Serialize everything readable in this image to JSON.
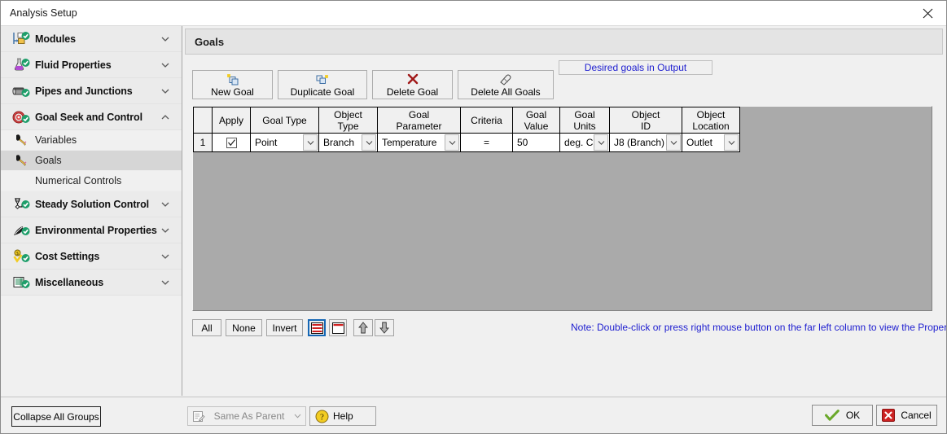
{
  "window": {
    "title": "Analysis Setup",
    "close_icon": "close-icon"
  },
  "sidebar": {
    "items": [
      {
        "label": "Modules",
        "icon": "modules-icon",
        "type": "group",
        "expanded": false,
        "selected": false
      },
      {
        "label": "Fluid Properties",
        "icon": "flask-icon",
        "type": "group",
        "expanded": false,
        "selected": false
      },
      {
        "label": "Pipes and Junctions",
        "icon": "pipe-icon",
        "type": "group",
        "expanded": false,
        "selected": false
      },
      {
        "label": "Goal Seek and Control",
        "icon": "target-icon",
        "type": "group",
        "expanded": true,
        "selected": false
      },
      {
        "label": "Variables",
        "icon": "variables-icon",
        "type": "sub",
        "selected": false
      },
      {
        "label": "Goals",
        "icon": "goals-icon",
        "type": "sub",
        "selected": true
      },
      {
        "label": "Numerical Controls",
        "icon": "",
        "type": "sub",
        "selected": false
      },
      {
        "label": "Steady Solution Control",
        "icon": "solution-icon",
        "type": "group",
        "expanded": false,
        "selected": false
      },
      {
        "label": "Environmental Properties",
        "icon": "leaf-icon",
        "type": "group",
        "expanded": false,
        "selected": false
      },
      {
        "label": "Cost Settings",
        "icon": "cost-icon",
        "type": "group",
        "expanded": false,
        "selected": false
      },
      {
        "label": "Miscellaneous",
        "icon": "list-icon",
        "type": "group",
        "expanded": false,
        "selected": false
      }
    ],
    "collapse_all_label": "Collapse All Groups"
  },
  "main": {
    "header_title": "Goals",
    "toolbar": [
      {
        "label": "New Goal",
        "icon": "new-goal-icon"
      },
      {
        "label": "Duplicate Goal",
        "icon": "duplicate-goal-icon"
      },
      {
        "label": "Delete Goal",
        "icon": "delete-goal-icon"
      },
      {
        "label": "Delete All Goals",
        "icon": "eraser-icon"
      }
    ],
    "desired_goals_label": "Desired goals in Output",
    "table": {
      "columns": [
        {
          "key": "rownum",
          "label": ""
        },
        {
          "key": "apply",
          "label": "Apply"
        },
        {
          "key": "goaltype",
          "label": "Goal Type"
        },
        {
          "key": "objtype",
          "label": "Object\nType"
        },
        {
          "key": "goalparam",
          "label": "Goal\nParameter"
        },
        {
          "key": "criteria",
          "label": "Criteria"
        },
        {
          "key": "goalvalue",
          "label": "Goal\nValue"
        },
        {
          "key": "goalunits",
          "label": "Goal\nUnits"
        },
        {
          "key": "objid",
          "label": "Object\nID"
        },
        {
          "key": "objloc",
          "label": "Object\nLocation"
        }
      ],
      "column_labels": {
        "rownum": "",
        "apply": "Apply",
        "goaltype": "Goal Type",
        "objtype_l1": "Object",
        "objtype_l2": "Type",
        "goalparam_l1": "Goal",
        "goalparam_l2": "Parameter",
        "criteria": "Criteria",
        "goalvalue_l1": "Goal",
        "goalvalue_l2": "Value",
        "goalunits_l1": "Goal",
        "goalunits_l2": "Units",
        "objid_l1": "Object",
        "objid_l2": "ID",
        "objloc_l1": "Object",
        "objloc_l2": "Location"
      },
      "rows": [
        {
          "rownum": "1",
          "apply": true,
          "goaltype": "Point",
          "objtype": "Branch",
          "goalparam": "Temperature",
          "criteria": "=",
          "goalvalue": "50",
          "goalunits": "deg. C",
          "objid": "J8 (Branch)",
          "objloc": "Outlet"
        }
      ]
    },
    "selection_bar": {
      "all_label": "All",
      "none_label": "None",
      "invert_label": "Invert",
      "view_all_rows_icon": "grid-all-rows-icon",
      "view_header_only_icon": "grid-header-only-icon",
      "move_up_icon": "arrow-up-icon",
      "move_down_icon": "arrow-down-icon"
    },
    "note": "Note: Double-click or press right mouse button on the far left column to view the Properties or inspection window for a pipe or junction."
  },
  "footer": {
    "parent_combo_value": "Same As Parent",
    "parent_combo_icon": "edit-note-icon",
    "help_label": "Help",
    "help_icon": "help-icon",
    "ok_label": "OK",
    "ok_icon": "check-icon",
    "cancel_label": "Cancel",
    "cancel_icon": "cancel-icon"
  },
  "colors": {
    "accent_blue": "#2020d0",
    "grid_background": "#aaaaaa",
    "panel": "#f0f0f0",
    "selected_item": "#d6d6d6",
    "ok_green": "#6aa82a",
    "cancel_red": "#cc2222"
  }
}
